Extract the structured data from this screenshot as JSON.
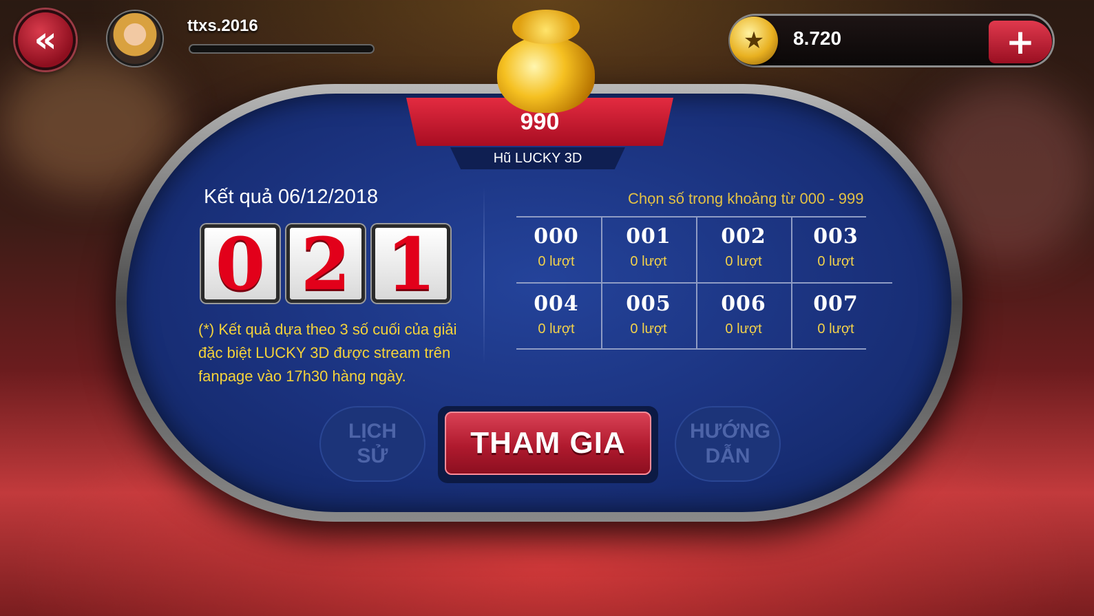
{
  "header": {
    "username": "ttxs.2016",
    "coins": "8.720",
    "back_icon": "double-chevron-left-icon",
    "add_icon": "plus-icon",
    "coin_icon": "star-coin-icon"
  },
  "jackpot": {
    "value": "990",
    "label": "Hũ LUCKY 3D"
  },
  "result": {
    "title": "Kết quả 06/12/2018",
    "digits": [
      "0",
      "2",
      "1"
    ],
    "note": "(*) Kết quả dựa theo 3 số cuối của giải đặc biệt LUCKY 3D được stream trên fanpage vào 17h30 hàng ngày."
  },
  "picker": {
    "hint": "Chọn số trong khoảng từ 000 - 999",
    "numbers": [
      {
        "num": "000",
        "turns": "0 lượt"
      },
      {
        "num": "001",
        "turns": "0 lượt"
      },
      {
        "num": "002",
        "turns": "0 lượt"
      },
      {
        "num": "003",
        "turns": "0 lượt"
      },
      {
        "num": "004",
        "turns": "0 lượt"
      },
      {
        "num": "005",
        "turns": "0 lượt"
      },
      {
        "num": "006",
        "turns": "0 lượt"
      },
      {
        "num": "007",
        "turns": "0 lượt"
      }
    ]
  },
  "buttons": {
    "history": "LỊCH SỬ",
    "join": "THAM GIA",
    "guide": "HƯỚNG DẪN"
  },
  "colors": {
    "accent_red": "#c8182e",
    "felt_blue": "#1a317c",
    "gold_text": "#f3d24a"
  }
}
